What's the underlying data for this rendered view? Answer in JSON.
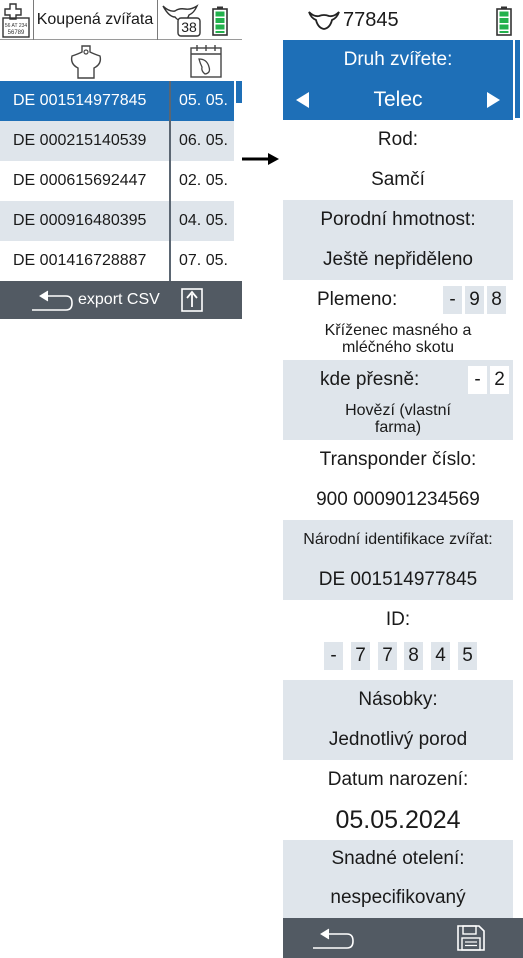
{
  "left_panel": {
    "header": {
      "title": "Koupená zvířata",
      "badge_count": "38",
      "battery_icon": "battery-icon"
    },
    "rows": [
      {
        "id": "DE 001514977845",
        "date": "05. 05.",
        "selected": true
      },
      {
        "id": "DE 000215140539",
        "date": "06. 05."
      },
      {
        "id": "DE 000615692447",
        "date": "02. 05."
      },
      {
        "id": "DE 000916480395",
        "date": "04. 05."
      },
      {
        "id": "DE 001416728887",
        "date": "07. 05."
      }
    ],
    "footer": {
      "export_label": "export CSV"
    }
  },
  "right_panel": {
    "header": {
      "animal_id": "77845"
    },
    "druh": {
      "label": "Druh zvířete:",
      "value": "Telec"
    },
    "rod": {
      "label": "Rod:",
      "value": "Samčí"
    },
    "porodni_hmotnost": {
      "label": "Porodní hmotnost:",
      "value": "Ještě nepřiděleno"
    },
    "plemeno": {
      "label": "Plemeno:",
      "digits": [
        "-",
        "9",
        "8"
      ],
      "description": "Kříženec masného a mléčného skotu"
    },
    "kde_presne": {
      "label": "kde přesně:",
      "digits": [
        "-",
        "2"
      ],
      "description": "Hovězí (vlastní farma)"
    },
    "transponder": {
      "label": "Transponder číslo:",
      "value": "900 000901234569"
    },
    "narodni_id": {
      "label": "Národní identifikace zvířat:",
      "value": "DE 001514977845"
    },
    "id": {
      "label": "ID:",
      "digits": [
        "-",
        "7",
        "7",
        "8",
        "4",
        "5"
      ]
    },
    "nasobky": {
      "label": "Násobky:",
      "value": "Jednotlivý porod"
    },
    "datum_narozeni": {
      "label": "Datum narození:",
      "value": "05.05.2024"
    },
    "snadne_oteleni": {
      "label": "Snadné otelení:",
      "value": "nespecifikovaný"
    }
  },
  "colors": {
    "accent_blue": "#1e6fb7",
    "light_gray": "#dfe5eb",
    "footer_gray": "#525a63",
    "battery_green": "#22b14c"
  }
}
